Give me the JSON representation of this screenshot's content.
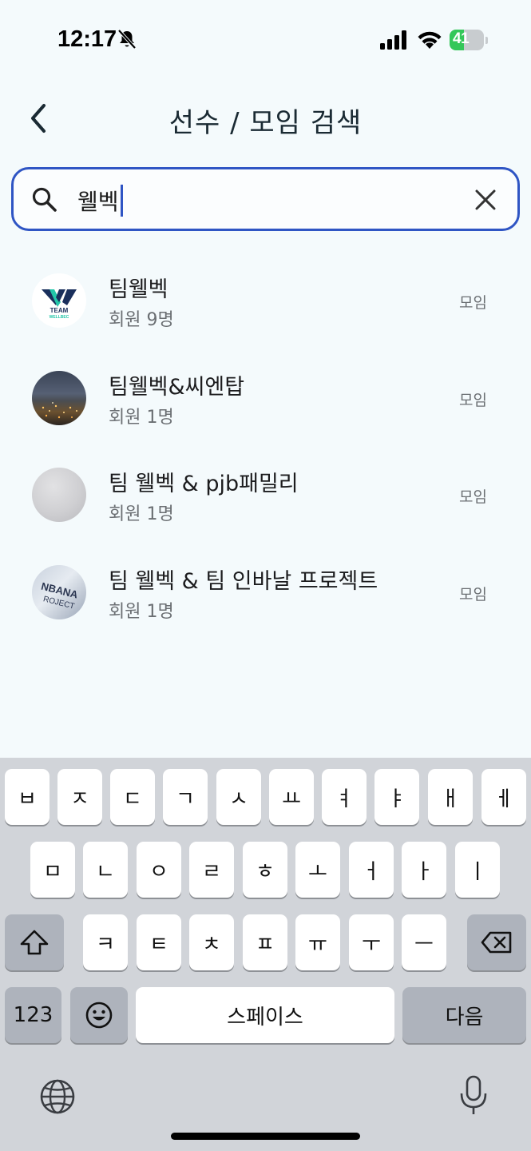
{
  "status_bar": {
    "time": "12:17",
    "battery_text": "41",
    "battery_level": 0.41,
    "icons": [
      "bell-slash-icon",
      "signal-icon",
      "wifi-icon",
      "battery-charging-icon"
    ]
  },
  "header": {
    "title": "선수 / 모임 검색",
    "back_icon": "chevron-left-icon"
  },
  "search": {
    "value": "웰벡",
    "search_icon": "search-icon",
    "clear_icon": "close-icon",
    "accent_color": "#2f55c4"
  },
  "results": [
    {
      "name": "팀웰벡",
      "members": "회원 9명",
      "type": "모임",
      "avatar": "team-wellbeck-logo"
    },
    {
      "name": "팀웰벡&씨엔탑",
      "members": "회원 1명",
      "type": "모임",
      "avatar": "city-night-photo"
    },
    {
      "name": "팀 웰벡 & pjb패밀리",
      "members": "회원 1명",
      "type": "모임",
      "avatar": "grey-blank-photo"
    },
    {
      "name": "팀 웰벡 & 팀 인바날 프로젝트",
      "members": "회원 1명",
      "type": "모임",
      "avatar": "inbanal-project-photo"
    }
  ],
  "avatar_logo_text": [
    "TEAM",
    "WELLBEC"
  ],
  "avatar_photo_text": [
    "NBANA",
    "ROJECT"
  ],
  "keyboard": {
    "row1": [
      "ㅂ",
      "ㅈ",
      "ㄷ",
      "ㄱ",
      "ㅅ",
      "ㅛ",
      "ㅕ",
      "ㅑ",
      "ㅐ",
      "ㅔ"
    ],
    "row2": [
      "ㅁ",
      "ㄴ",
      "ㅇ",
      "ㄹ",
      "ㅎ",
      "ㅗ",
      "ㅓ",
      "ㅏ",
      "ㅣ"
    ],
    "row3": [
      "ㅋ",
      "ㅌ",
      "ㅊ",
      "ㅍ",
      "ㅠ",
      "ㅜ",
      "ㅡ"
    ],
    "numbers_label": "123",
    "space_label": "스페이스",
    "return_label": "다음",
    "icons": [
      "shift-icon",
      "backspace-icon",
      "emoji-icon",
      "globe-icon",
      "microphone-icon"
    ]
  }
}
